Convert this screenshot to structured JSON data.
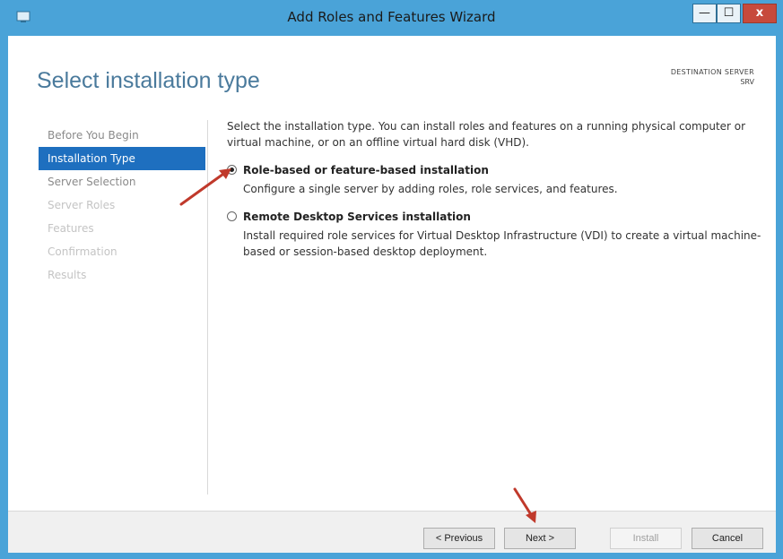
{
  "window": {
    "title": "Add Roles and Features Wizard",
    "minimize_glyph": "—",
    "maximize_glyph": "☐",
    "close_glyph": "x"
  },
  "page": {
    "title": "Select installation type",
    "destination_label": "DESTINATION SERVER",
    "destination_name": "SRV"
  },
  "nav": {
    "items": [
      {
        "label": "Before You Begin",
        "state": "normal"
      },
      {
        "label": "Installation Type",
        "state": "active"
      },
      {
        "label": "Server Selection",
        "state": "normal"
      },
      {
        "label": "Server Roles",
        "state": "disabled"
      },
      {
        "label": "Features",
        "state": "disabled"
      },
      {
        "label": "Confirmation",
        "state": "disabled"
      },
      {
        "label": "Results",
        "state": "disabled"
      }
    ]
  },
  "content": {
    "intro": "Select the installation type. You can install roles and features on a running physical computer or virtual machine, or on an offline virtual hard disk (VHD).",
    "options": [
      {
        "title": "Role-based or feature-based installation",
        "description": "Configure a single server by adding roles, role services, and features.",
        "selected": true
      },
      {
        "title": "Remote Desktop Services installation",
        "description": "Install required role services for Virtual Desktop Infrastructure (VDI) to create a virtual machine-based or session-based desktop deployment.",
        "selected": false
      }
    ]
  },
  "buttons": {
    "previous": "< Previous",
    "next": "Next >",
    "install": "Install",
    "cancel": "Cancel"
  },
  "colors": {
    "titlebar": "#4aa3d8",
    "active_nav": "#1e6fbf",
    "annotation_arrow": "#c0392b",
    "close_button": "#c74a3c"
  }
}
